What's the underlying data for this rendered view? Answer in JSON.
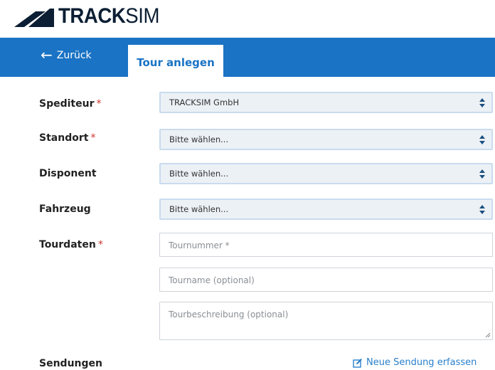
{
  "brand": {
    "name_bold": "TRACK",
    "name_light": "SIM",
    "color": "#0b1e33"
  },
  "nav": {
    "back_label": "Zurück",
    "active_tab": "Tour anlegen",
    "bar_color": "#1a73c4"
  },
  "form": {
    "required_marker": "*",
    "forwarder": {
      "label": "Spediteur",
      "value": "TRACKSIM GmbH",
      "required": true
    },
    "location": {
      "label": "Standort",
      "value": "Bitte wählen...",
      "required": true
    },
    "dispatcher": {
      "label": "Disponent",
      "value": "Bitte wählen...",
      "required": false
    },
    "vehicle": {
      "label": "Fahrzeug",
      "value": "Bitte wählen...",
      "required": false
    },
    "tour_data": {
      "label": "Tourdaten",
      "required": true,
      "tour_number_placeholder": "Tournummer *",
      "tour_name_placeholder": "Tourname (optional)",
      "tour_description_placeholder": "Tourbeschreibung (optional)"
    }
  },
  "shipments": {
    "label": "Sendungen",
    "new_shipment_label": "Neue Sendung erfassen",
    "link_color": "#2a80cc"
  },
  "icons": {
    "back": "arrow-left-icon",
    "select": "up-down-chevron-icon",
    "edit": "edit-icon"
  }
}
